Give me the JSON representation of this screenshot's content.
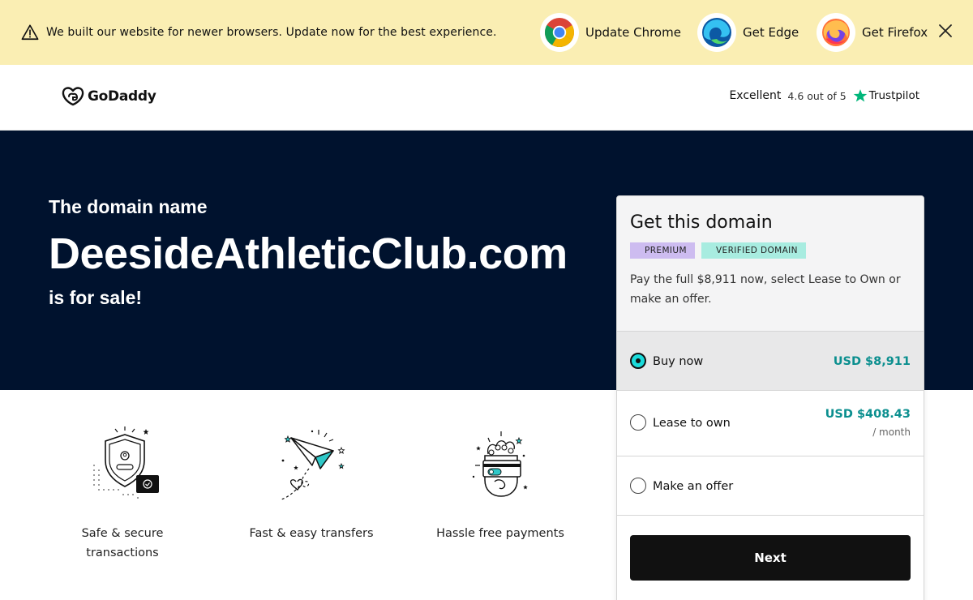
{
  "banner": {
    "message": "We built our website for newer browsers. Update now for the best experience.",
    "browsers": [
      {
        "label": "Update Chrome",
        "icon": "chrome-icon"
      },
      {
        "label": "Get Edge",
        "icon": "edge-icon"
      },
      {
        "label": "Get Firefox",
        "icon": "firefox-icon"
      }
    ],
    "close_icon": "close-icon"
  },
  "header": {
    "logo_text": "GoDaddy",
    "trust_excellent": "Excellent",
    "trust_score": "4.6 out of 5",
    "trust_brand": "Trustpilot"
  },
  "hero": {
    "intro": "The domain name",
    "domain": "DeesideAthleticClub.com",
    "sale": "is for sale!"
  },
  "features": [
    {
      "label": "Safe & secure transactions",
      "icon": "shield-icon"
    },
    {
      "label": "Fast & easy transfers",
      "icon": "paper-plane-icon"
    },
    {
      "label": "Hassle free payments",
      "icon": "payment-card-icon"
    }
  ],
  "card": {
    "title": "Get this domain",
    "badge_premium": "PREMIUM",
    "badge_verified": "VERIFIED DOMAIN",
    "description": "Pay the full $8,911 now, select Lease to Own or make an offer.",
    "options": [
      {
        "label": "Buy now",
        "price": "USD $8,911",
        "sub": "",
        "selected": true
      },
      {
        "label": "Lease to own",
        "price": "USD $408.43",
        "sub": "/ month",
        "selected": false
      },
      {
        "label": "Make an offer",
        "price": "",
        "sub": "",
        "selected": false
      }
    ],
    "next_label": "Next"
  },
  "colors": {
    "banner_bg": "#faeeb3",
    "hero_bg": "#00122e",
    "accent_teal": "#0b8f8f",
    "radio_teal": "#1bdbdb",
    "trustpilot_green": "#00b67a"
  }
}
